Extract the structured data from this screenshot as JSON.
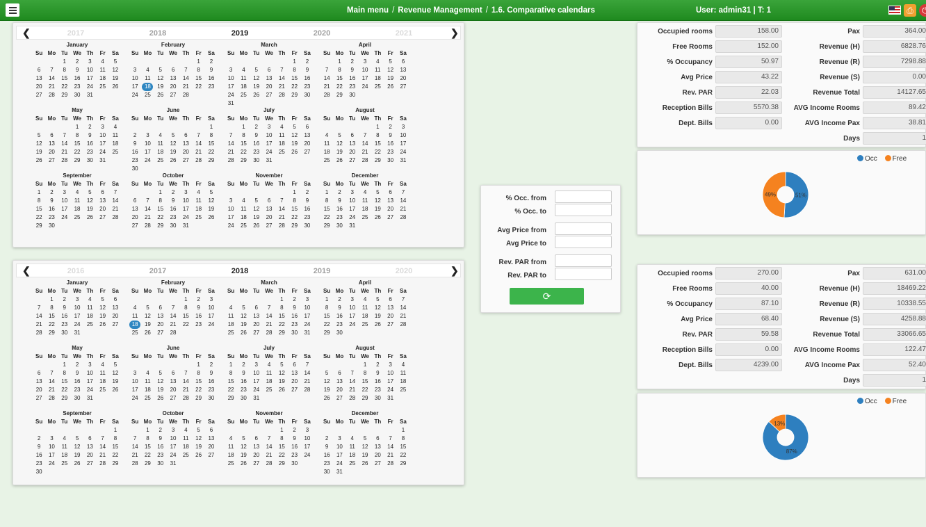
{
  "topbar": {
    "breadcrumb": [
      "Main menu",
      "Revenue Management",
      "1.6. Comparative calendars"
    ],
    "separator": "/",
    "user": "User: admin31 | T: 1"
  },
  "icons": {
    "menu": "hamburger-menu-icon",
    "flag": "us-flag-icon",
    "print": "printer-icon",
    "logout": "power-icon",
    "refresh": "refresh-icon",
    "prev": "chevron-left-icon",
    "next": "chevron-right-icon"
  },
  "weekdays": [
    "Su",
    "Mo",
    "Tu",
    "We",
    "Th",
    "Fr",
    "Sa"
  ],
  "calendars": [
    {
      "years": [
        "2017",
        "2018",
        "2019",
        "2020",
        "2021"
      ],
      "year": 2019,
      "selected": {
        "month": 2,
        "day": 18
      },
      "months": [
        "January",
        "February",
        "March",
        "April",
        "May",
        "June",
        "July",
        "August",
        "September",
        "October",
        "November",
        "December"
      ]
    },
    {
      "years": [
        "2016",
        "2017",
        "2018",
        "2019",
        "2020"
      ],
      "year": 2018,
      "selected": {
        "month": 2,
        "day": 18
      },
      "months": [
        "January",
        "February",
        "March",
        "April",
        "May",
        "June",
        "July",
        "August",
        "September",
        "October",
        "November",
        "December"
      ]
    }
  ],
  "filter": {
    "occ_from": "% Occ. from",
    "occ_to": "% Occ. to",
    "price_from": "Avg Price from",
    "price_to": "Avg Price to",
    "revpar_from": "Rev. PAR from",
    "revpar_to": "Rev. PAR to"
  },
  "stats": [
    {
      "left": [
        {
          "label": "Occupied rooms",
          "value": "158.00"
        },
        {
          "label": "Free Rooms",
          "value": "152.00"
        },
        {
          "label": "% Occupancy",
          "value": "50.97"
        },
        {
          "label": "Avg Price",
          "value": "43.22"
        },
        {
          "label": "Rev. PAR",
          "value": "22.03"
        },
        {
          "label": "Reception Bills",
          "value": "5570.38"
        },
        {
          "label": "Dept. Bills",
          "value": "0.00"
        }
      ],
      "right": [
        {
          "label": "Pax",
          "value": "364.00"
        },
        {
          "label": "Revenue (H)",
          "value": "6828.76"
        },
        {
          "label": "Revenue (R)",
          "value": "7298.88"
        },
        {
          "label": "Revenue (S)",
          "value": "0.00"
        },
        {
          "label": "Revenue Total",
          "value": "14127.65"
        },
        {
          "label": "AVG Income Rooms",
          "value": "89.42"
        },
        {
          "label": "AVG Income Pax",
          "value": "38.81"
        },
        {
          "label": "Days",
          "value": "1"
        }
      ]
    },
    {
      "left": [
        {
          "label": "Occupied rooms",
          "value": "270.00"
        },
        {
          "label": "Free Rooms",
          "value": "40.00"
        },
        {
          "label": "% Occupancy",
          "value": "87.10"
        },
        {
          "label": "Avg Price",
          "value": "68.40"
        },
        {
          "label": "Rev. PAR",
          "value": "59.58"
        },
        {
          "label": "Reception Bills",
          "value": "0.00"
        },
        {
          "label": "Dept. Bills",
          "value": "4239.00"
        }
      ],
      "right": [
        {
          "label": "Pax",
          "value": "631.00"
        },
        {
          "label": "Revenue (H)",
          "value": "18469.22"
        },
        {
          "label": "Revenue (R)",
          "value": "10338.55"
        },
        {
          "label": "Revenue (S)",
          "value": "4258.88"
        },
        {
          "label": "Revenue Total",
          "value": "33066.65"
        },
        {
          "label": "AVG Income Rooms",
          "value": "122.47"
        },
        {
          "label": "AVG Income Pax",
          "value": "52.40"
        },
        {
          "label": "Days",
          "value": "1"
        }
      ]
    }
  ],
  "colors": {
    "occ": "#2e7fbf",
    "free": "#f5821f",
    "selected_day": "#2e86c1",
    "topbar": "#2a9a2a",
    "refresh": "#3cb44b"
  },
  "chart_data": [
    {
      "type": "pie",
      "legend": [
        "Occ",
        "Free"
      ],
      "values": [
        51,
        49
      ],
      "labels": [
        "51%",
        "49%"
      ]
    },
    {
      "type": "pie",
      "legend": [
        "Occ",
        "Free"
      ],
      "values": [
        87,
        13
      ],
      "labels": [
        "87%",
        "13%"
      ]
    }
  ]
}
